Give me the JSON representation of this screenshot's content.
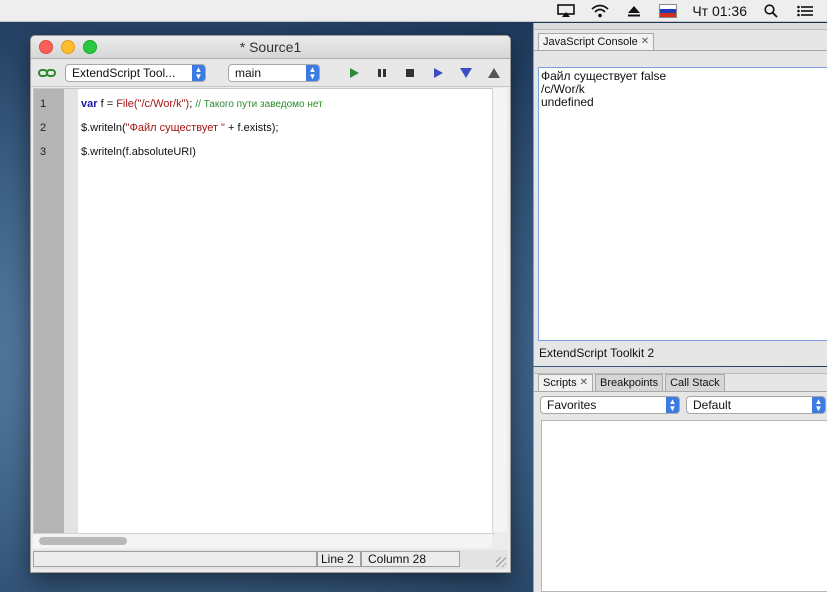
{
  "menubar": {
    "clock": "Чт 01:36"
  },
  "editor": {
    "title": "* Source1",
    "engine_select": "ExtendScript Tool...",
    "function_select": "main",
    "lines": [
      {
        "num": "1",
        "kw": "var",
        "plain1": " f = ",
        "str_part": "File(\"/c/Wor/k\")",
        "plain2": "; ",
        "comment": "// Такого пути заведомо нет"
      },
      {
        "num": "2",
        "text_a": "$.writeln(",
        "str_part": "\"Файл существует \"",
        "text_b": " + f.exists);"
      },
      {
        "num": "3",
        "text_a": "$.writeln(f.absoluteURI)"
      }
    ],
    "status": {
      "line": "Line 2",
      "column": "Column 28"
    }
  },
  "console_panel": {
    "tab_label": "JavaScript Console",
    "output": [
      "Файл существует false",
      "/c/Wor/k",
      "undefined"
    ],
    "target_label": "ExtendScript Toolkit 2"
  },
  "scripts_panel": {
    "tabs": [
      "Scripts",
      "Breakpoints",
      "Call Stack"
    ],
    "left_select": "Favorites",
    "right_select": "Default"
  },
  "colors": {
    "run": "#2e8b3a",
    "step": "#3b4ec4",
    "accent": "#3b7ce4"
  }
}
